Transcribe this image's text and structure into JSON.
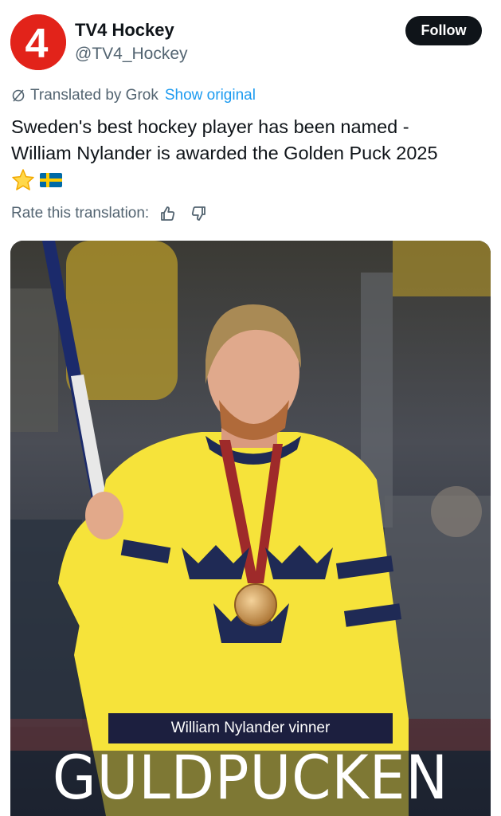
{
  "account": {
    "name": "TV4 Hockey",
    "handle": "@TV4_Hockey",
    "avatar_text": "4",
    "avatar_color": "#e2231a"
  },
  "follow_label": "Follow",
  "translation": {
    "label": "Translated by Grok",
    "show_original": "Show original",
    "icon": "slash-circle-icon"
  },
  "tweet": {
    "line1": "Sweden's best hockey player has been named -",
    "line2": "William Nylander is awarded the Golden Puck 2025",
    "emojis": [
      "star-icon",
      "sweden-flag-icon"
    ]
  },
  "rate": {
    "label": "Rate this translation:",
    "icons": [
      "thumbs-up-icon",
      "thumbs-down-icon"
    ]
  },
  "media": {
    "caption": "William Nylander vinner",
    "headline": "GULDPUCKEN",
    "jersey_color": "#f6e33a",
    "crown_color": "#1f2a55"
  },
  "colors": {
    "link": "#1d9bf0",
    "secondary_text": "#536471",
    "primary_text": "#0f1419"
  }
}
